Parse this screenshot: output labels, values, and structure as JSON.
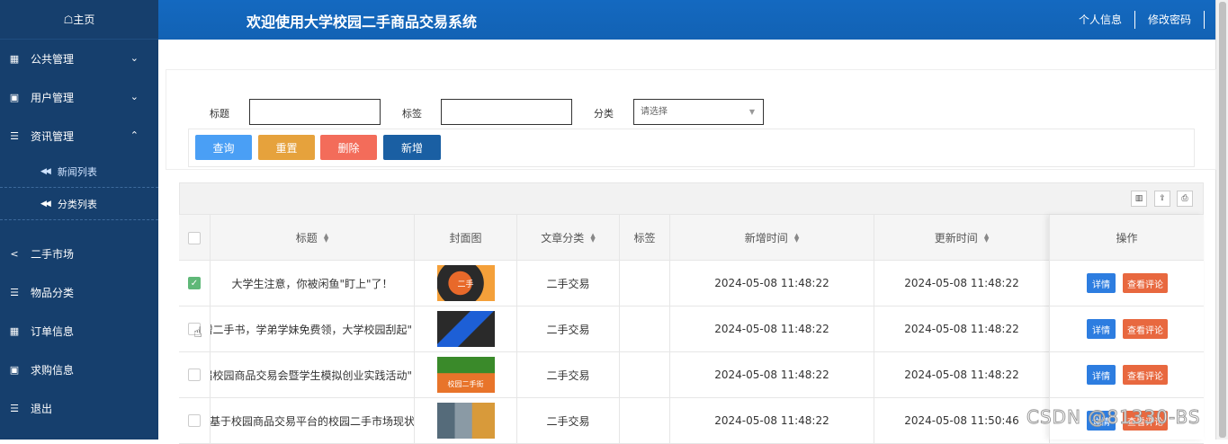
{
  "sidebar": {
    "home": "☖主页",
    "items": [
      {
        "icon": "grid-icon",
        "label": "公共管理",
        "chevron": "⌄"
      },
      {
        "icon": "book-icon",
        "label": "用户管理",
        "chevron": "⌄"
      },
      {
        "icon": "list-icon",
        "label": "资讯管理",
        "chevron": "⌃"
      }
    ],
    "subitems": [
      {
        "label": "新闻列表",
        "active": true
      },
      {
        "label": "分类列表",
        "active": false
      }
    ],
    "bottom_items": [
      {
        "icon": "share-icon",
        "label": "二手市场"
      },
      {
        "icon": "list-icon",
        "label": "物品分类"
      },
      {
        "icon": "grid-icon",
        "label": "订单信息"
      },
      {
        "icon": "book-icon",
        "label": "求购信息"
      },
      {
        "icon": "list-icon",
        "label": "退出"
      }
    ]
  },
  "header": {
    "title": "欢迎使用大学校园二手商品交易系统",
    "links": [
      "个人信息",
      "修改密码"
    ]
  },
  "search": {
    "title_label": "标题",
    "tag_label": "标签",
    "category_label": "分类",
    "category_placeholder": "请选择",
    "buttons": {
      "query": "查询",
      "reset": "重置",
      "delete": "删除",
      "add": "新增"
    }
  },
  "colors": {
    "sidebar": "#163f6d",
    "topbar": "#1469c0",
    "query": "#4a9ff5",
    "reset": "#e6a23c",
    "delete": "#f36c5a",
    "add": "#1a5fa3",
    "detail": "#2d7de0",
    "comment": "#e8683f"
  },
  "table": {
    "headers": {
      "title": "标题",
      "cover": "封面图",
      "category": "文章分类",
      "tag": "标签",
      "created": "新增时间",
      "updated": "更新时间",
      "actions": "操作"
    },
    "detail_label": "详情",
    "comment_label": "查看评论",
    "rows": [
      {
        "checked": true,
        "title": "大学生注意，你被闲鱼\"盯上\"了！",
        "cover_text": "二手",
        "category": "二手交易",
        "tag": "",
        "created": "2024-05-08 11:48:22",
        "updated": "2024-05-08 11:48:22"
      },
      {
        "checked": false,
        "title": "捐赠二手书，学弟学妹免费领，大学校园刮起\"",
        "cover_text": "",
        "category": "二手交易",
        "tag": "",
        "created": "2024-05-08 11:48:22",
        "updated": "2024-05-08 11:48:22"
      },
      {
        "checked": false,
        "title": "三届校园商品交易会暨学生模拟创业实践活动\"",
        "cover_text": "校园二手街",
        "category": "二手交易",
        "tag": "",
        "created": "2024-05-08 11:48:22",
        "updated": "2024-05-08 11:48:22"
      },
      {
        "checked": false,
        "title": "基于校园商品交易平台的校园二手市场现状",
        "cover_text": "",
        "category": "二手交易",
        "tag": "",
        "created": "2024-05-08 11:48:22",
        "updated": "2024-05-08 11:50:46"
      }
    ]
  },
  "watermark": "CSDN @81330-BS"
}
